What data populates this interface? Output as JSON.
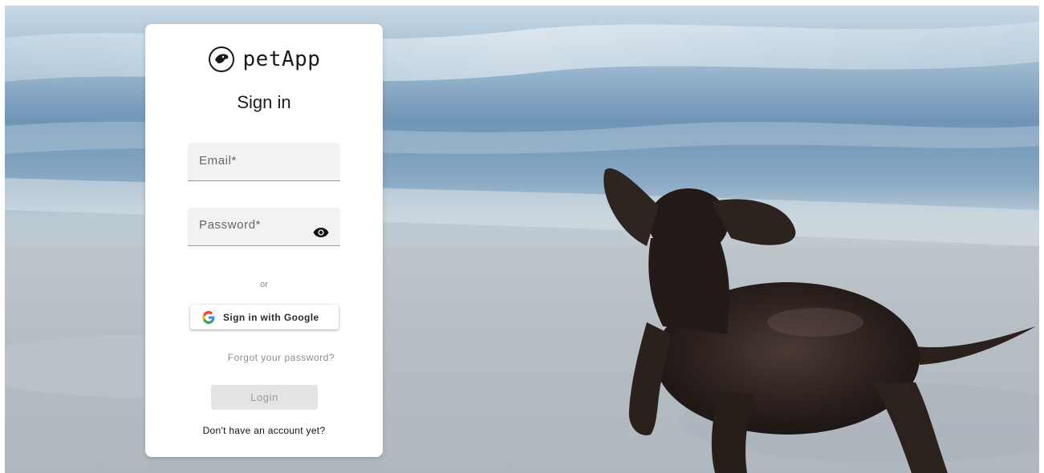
{
  "app": {
    "brand_name": "petApp",
    "logo_icon": "dog-face-logo-icon"
  },
  "login_card": {
    "heading": "Sign in",
    "email_field": {
      "placeholder": "Email*",
      "value": ""
    },
    "password_field": {
      "placeholder": "Password*",
      "value": "",
      "toggle_icon": "eye-icon"
    },
    "divider_text": "or",
    "google_button": {
      "label": "Sign in with Google",
      "icon": "google-g-icon"
    },
    "forgot_password_link": "Forgot your password?",
    "login_button": {
      "label": "Login",
      "state": "disabled"
    },
    "signup_link": "Don't have an account yet?"
  },
  "background": {
    "image": "dachshund-on-beach-photo"
  },
  "colors": {
    "card_bg": "#ffffff",
    "field_bg": "#f2f2f2",
    "login_button_disabled_bg": "#e4e4e4",
    "muted_text": "#8c8c8c"
  }
}
